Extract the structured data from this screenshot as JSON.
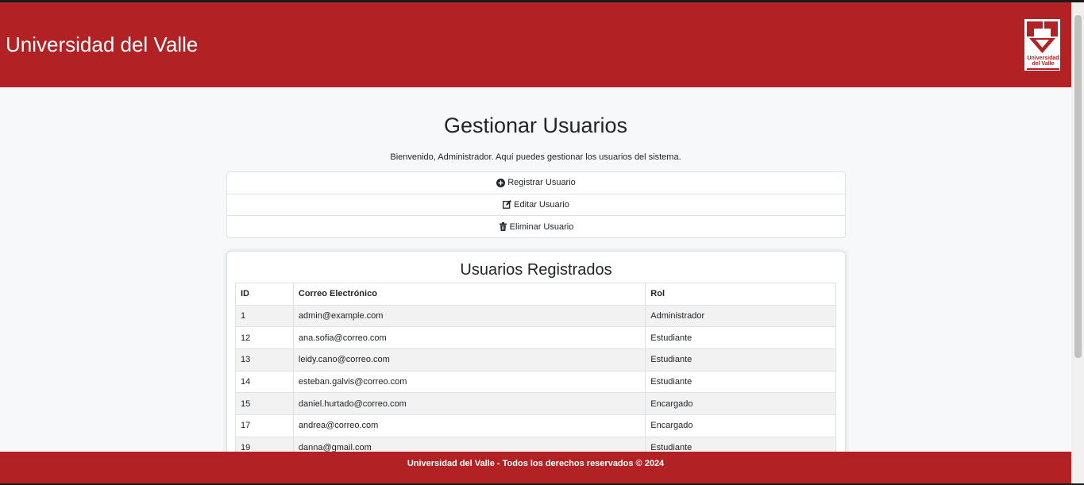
{
  "header": {
    "title": "Universidad del Valle",
    "logo_line1": "Universidad",
    "logo_line2": "del Valle",
    "brand_color": "#b22123"
  },
  "main": {
    "page_title": "Gestionar Usuarios",
    "welcome": "Bienvenido, Administrador. Aquí puedes gestionar los usuarios del sistema.",
    "actions": [
      {
        "label": "Registrar Usuario",
        "icon": "plus-circle-icon"
      },
      {
        "label": "Editar Usuario",
        "icon": "edit-icon"
      },
      {
        "label": "Eliminar Usuario",
        "icon": "trash-icon"
      }
    ]
  },
  "users": {
    "title": "Usuarios Registrados",
    "columns": [
      "ID",
      "Correo Electrónico",
      "Rol"
    ],
    "rows": [
      [
        "1",
        "admin@example.com",
        "Administrador"
      ],
      [
        "12",
        "ana.sofia@correo.com",
        "Estudiante"
      ],
      [
        "13",
        "leidy.cano@correo.com",
        "Estudiante"
      ],
      [
        "14",
        "esteban.galvis@correo.com",
        "Estudiante"
      ],
      [
        "15",
        "daniel.hurtado@correo.com",
        "Encargado"
      ],
      [
        "17",
        "andrea@correo.com",
        "Encargado"
      ],
      [
        "19",
        "danna@gmail.com",
        "Estudiante"
      ]
    ]
  },
  "footer": {
    "text": "Universidad del Valle - Todos los derechos reservados © 2024"
  }
}
